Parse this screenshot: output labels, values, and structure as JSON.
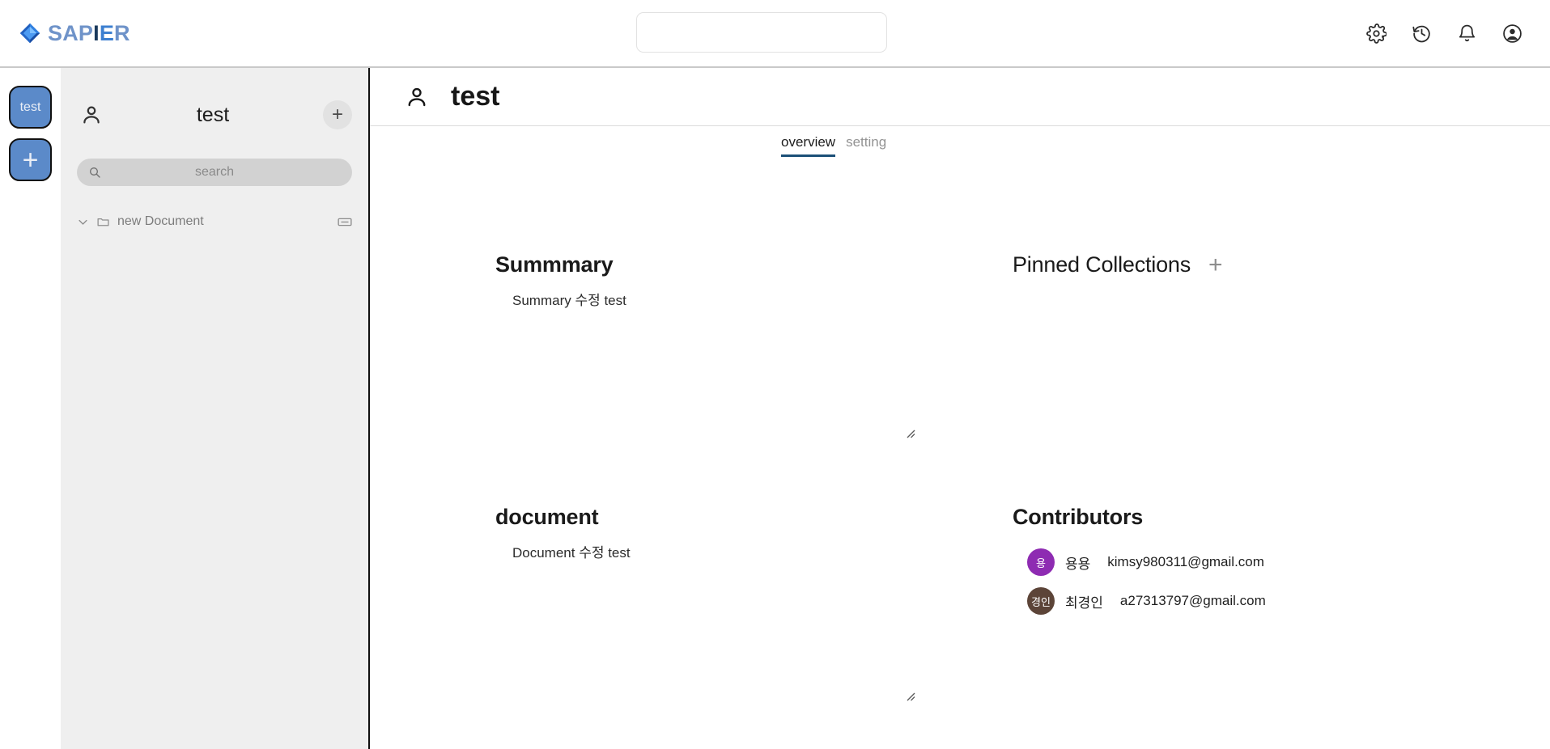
{
  "topbar": {
    "brand": {
      "part1": "SAP",
      "part2": "I",
      "part3": "E",
      "part4": "R",
      "full": "SAPIER"
    },
    "search": {
      "value": "",
      "placeholder": ""
    },
    "icons": [
      {
        "name": "settings-icon",
        "label": "settings"
      },
      {
        "name": "history-icon",
        "label": "history"
      },
      {
        "name": "notifications-icon",
        "label": "notifications"
      },
      {
        "name": "account-icon",
        "label": "account"
      }
    ]
  },
  "rail": {
    "workspaces": [
      {
        "label": "test",
        "type": "workspace"
      }
    ],
    "add_label": "+"
  },
  "sidebar": {
    "title": "test",
    "add_label": "+",
    "search": {
      "value": "",
      "placeholder": "search"
    },
    "tree": [
      {
        "label": "new Document",
        "expanded": true
      }
    ]
  },
  "main": {
    "title": "test",
    "tabs": [
      {
        "label": "overview",
        "active": true
      },
      {
        "label": "setting",
        "active": false
      }
    ],
    "summary": {
      "heading": "Summmary",
      "content": "Summary 수정 test"
    },
    "pinned_collections": {
      "heading": "Pinned Collections",
      "add_label": "+",
      "items": []
    },
    "document": {
      "heading": "document",
      "content": "Document 수정 test"
    },
    "contributors": {
      "heading": "Contributors",
      "people": [
        {
          "initials": "용",
          "name": "용용",
          "email": "kimsy980311@gmail.com",
          "color": "#8e2bb2"
        },
        {
          "initials": "경인",
          "name": "최경인",
          "email": "a27313797@gmail.com",
          "color": "#5c4438"
        }
      ]
    }
  },
  "colors": {
    "brand_blue": "#3c7fd0",
    "rail_button": "#5b8ac9",
    "sidebar_bg": "#efefef",
    "tab_active_underline": "#1b4f77"
  }
}
